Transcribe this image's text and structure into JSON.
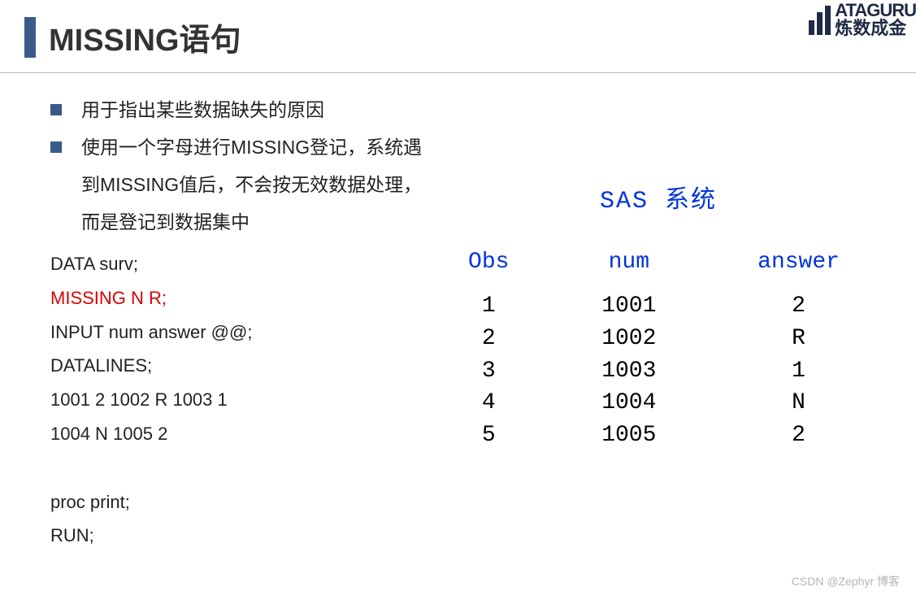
{
  "header": {
    "title": "MISSING语句",
    "logo_line1": "ATAGURU",
    "logo_line2": "炼数成金"
  },
  "bullets": [
    "用于指出某些数据缺失的原因",
    "使用一个字母进行MISSING登记，系统遇到MISSING值后，不会按无效数据处理，而是登记到数据集中"
  ],
  "code": {
    "line1": "DATA surv;",
    "line2": "MISSING N R;",
    "line3": "INPUT num answer @@;",
    "line4": "DATALINES;",
    "line5": "1001 2  1002 R  1003 1",
    "line6": "1004 N  1005 2",
    "line7": "",
    "line8": "proc print;",
    "line9": "RUN;"
  },
  "sas": {
    "title": "SAS 系统",
    "columns": [
      "Obs",
      "num",
      "answer"
    ],
    "rows": [
      {
        "obs": "1",
        "num": "1001",
        "answer": "2"
      },
      {
        "obs": "2",
        "num": "1002",
        "answer": "R"
      },
      {
        "obs": "3",
        "num": "1003",
        "answer": "1"
      },
      {
        "obs": "4",
        "num": "1004",
        "answer": "N"
      },
      {
        "obs": "5",
        "num": "1005",
        "answer": "2"
      }
    ]
  },
  "watermark": "CSDN @Zephyr 博客"
}
